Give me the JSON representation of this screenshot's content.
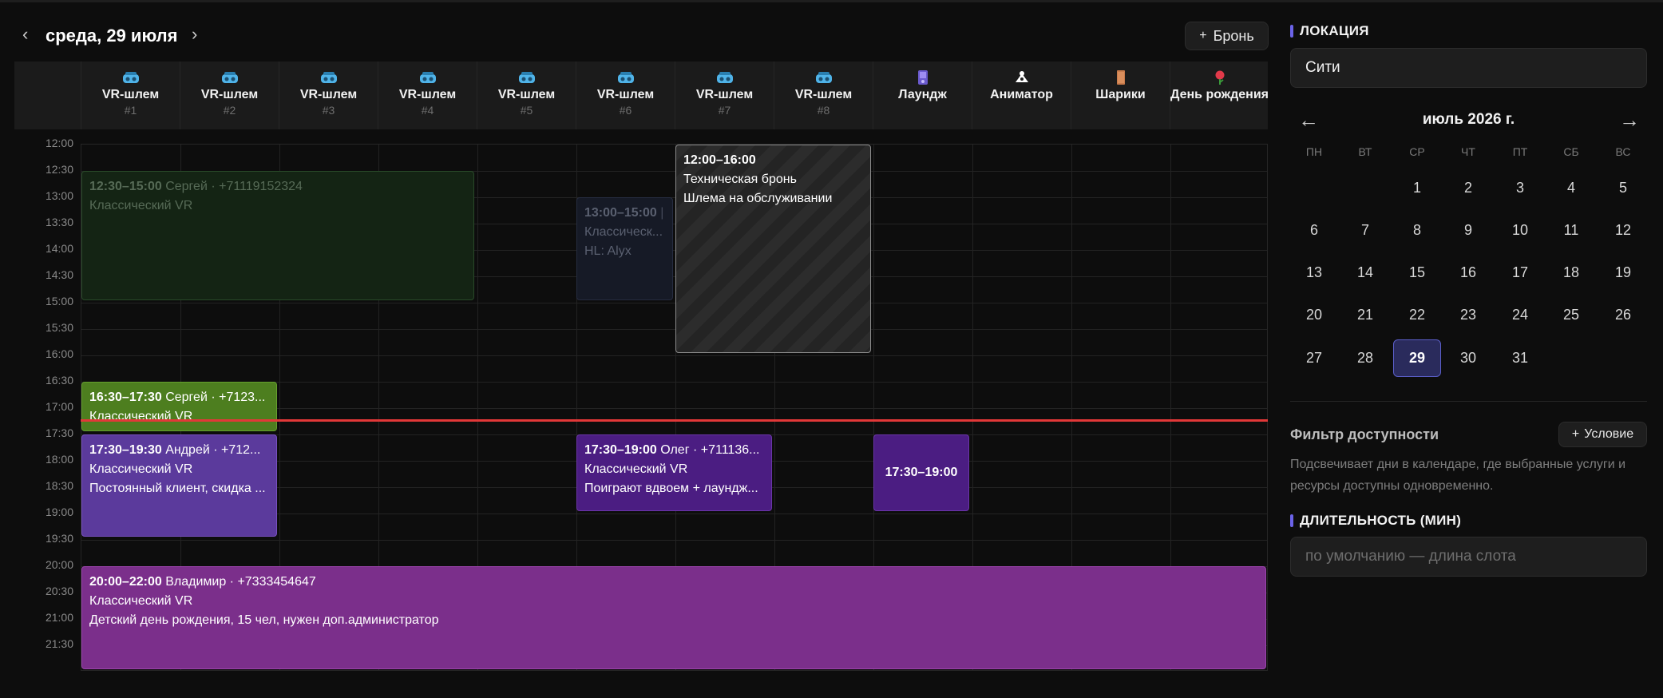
{
  "header": {
    "prev_label": "‹",
    "next_label": "›",
    "date": "среда, 29 июля",
    "add_booking": {
      "plus": "+",
      "label": "Бронь"
    }
  },
  "resources": [
    {
      "icon": "vr-headset-icon",
      "name": "VR-шлем",
      "num": "#1"
    },
    {
      "icon": "vr-headset-icon",
      "name": "VR-шлем",
      "num": "#2"
    },
    {
      "icon": "vr-headset-icon",
      "name": "VR-шлем",
      "num": "#3"
    },
    {
      "icon": "vr-headset-icon",
      "name": "VR-шлем",
      "num": "#4"
    },
    {
      "icon": "vr-headset-icon",
      "name": "VR-шлем",
      "num": "#5"
    },
    {
      "icon": "vr-headset-icon",
      "name": "VR-шлем",
      "num": "#6"
    },
    {
      "icon": "vr-headset-icon",
      "name": "VR-шлем",
      "num": "#7"
    },
    {
      "icon": "vr-headset-icon",
      "name": "VR-шлем",
      "num": "#8"
    },
    {
      "icon": "console-icon",
      "name": "Лаундж",
      "num": ""
    },
    {
      "icon": "animator-icon",
      "name": "Аниматор",
      "num": ""
    },
    {
      "icon": "balloons-icon",
      "name": "Шарики",
      "num": ""
    },
    {
      "icon": "birthday-icon",
      "name": "День рождения",
      "num": ""
    }
  ],
  "times": [
    "12:00",
    "12:30",
    "13:00",
    "13:30",
    "14:00",
    "14:30",
    "15:00",
    "15:30",
    "16:00",
    "16:30",
    "17:00",
    "17:30",
    "18:00",
    "18:30",
    "19:00",
    "19:30",
    "20:00",
    "20:30",
    "21:00",
    "21:30"
  ],
  "bookings": [
    {
      "time": "12:30–15:00",
      "who": "Сергей · +71119152324",
      "l2": "Классический VR",
      "l3": ""
    },
    {
      "time": "13:00–15:00",
      "who": "",
      "l2": "Классическ...",
      "l3": "HL: Alyx"
    },
    {
      "time": "12:00–16:00",
      "who": "",
      "l2": "Техническая бронь",
      "l3": "Шлема на обслуживании"
    },
    {
      "time": "16:30–17:30",
      "who": "Сергей · +7123...",
      "l2": "Классический VR",
      "l3": ""
    },
    {
      "time": "17:30–19:30",
      "who": "Андрей · +712...",
      "l2": "Классический VR",
      "l3": "Постоянный клиент, скидка ..."
    },
    {
      "time": "17:30–19:00",
      "who": "Олег · +711136...",
      "l2": "Классический VR",
      "l3": "Поиграют вдвоем + лаундж..."
    },
    {
      "time": "17:30–19:00",
      "who": "",
      "l2": "",
      "l3": ""
    },
    {
      "time": "20:00–22:00",
      "who": "Владимир · +7333454647",
      "l2": "Классический VR",
      "l3": "Детский день рождения, 15 чел, нужен доп.администратор"
    }
  ],
  "sidebar": {
    "location_title": "ЛОКАЦИЯ",
    "location_value": "Сити",
    "calendar": {
      "prev": "←",
      "next": "→",
      "month": "июль 2026 г.",
      "weekdays": [
        "ПН",
        "ВТ",
        "СР",
        "ЧТ",
        "ПТ",
        "СБ",
        "ВС"
      ],
      "days": [
        "1",
        "2",
        "3",
        "4",
        "5",
        "6",
        "7",
        "8",
        "9",
        "10",
        "11",
        "12",
        "13",
        "14",
        "15",
        "16",
        "17",
        "18",
        "19",
        "20",
        "21",
        "22",
        "23",
        "24",
        "25",
        "26",
        "27",
        "28",
        "29",
        "30",
        "31"
      ],
      "selected": "29"
    },
    "filter_title": "Фильтр доступности",
    "condition_button": {
      "plus": "+",
      "label": "Условие"
    },
    "filter_desc": "Подсвечивает дни в календаре, где выбранные услуги и ресурсы доступны одновременно.",
    "duration_title": "ДЛИТЕЛЬНОСТЬ (МИН)",
    "duration_placeholder": "по умолчанию — длина слота"
  },
  "colors": {
    "accent": "#6b63e8",
    "now_line": "#e23838",
    "booking_green": "#4d7e1f",
    "booking_purple": "#5b3a9c",
    "booking_violet": "#4b1d82",
    "booking_magenta": "#7b2f8b"
  }
}
